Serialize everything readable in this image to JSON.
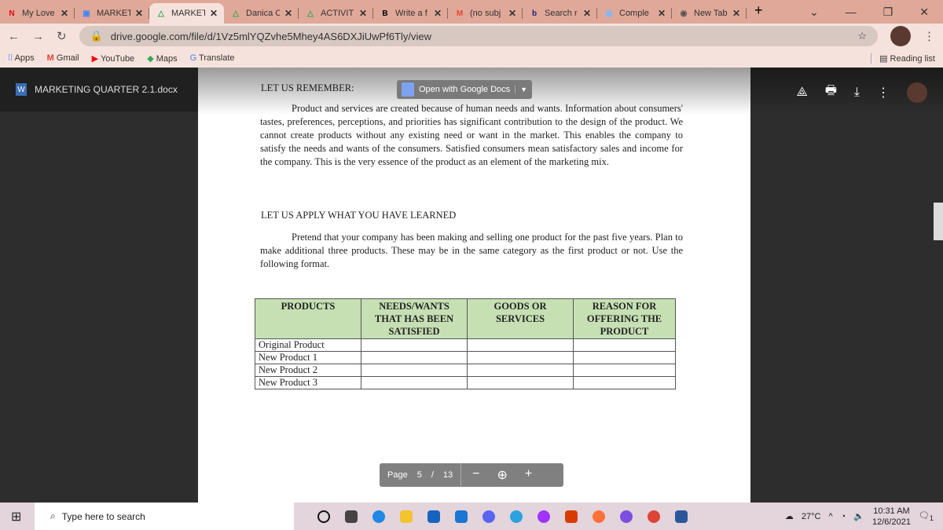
{
  "browser": {
    "tabs": [
      {
        "title": "My Love",
        "icon": "netflix-icon",
        "color": "#e50914",
        "glyph": "N"
      },
      {
        "title": "MARKET",
        "icon": "classroom-icon",
        "color": "#4285f4",
        "glyph": "▣"
      },
      {
        "title": "MARKET",
        "icon": "google-drive-icon",
        "color": "#34a853",
        "glyph": "△",
        "active": true
      },
      {
        "title": "Danica C",
        "icon": "google-drive-icon",
        "color": "#34a853",
        "glyph": "△"
      },
      {
        "title": "ACTIVITI",
        "icon": "google-drive-icon",
        "color": "#34a853",
        "glyph": "△"
      },
      {
        "title": "Write a f",
        "icon": "brainly-icon",
        "color": "#000000",
        "glyph": "B"
      },
      {
        "title": "(no subj",
        "icon": "gmail-icon",
        "color": "#ea4335",
        "glyph": "M"
      },
      {
        "title": "Search r",
        "icon": "bing-icon",
        "color": "#1a237e",
        "glyph": "b"
      },
      {
        "title": "Comple",
        "icon": "quizlet-icon",
        "color": "#8ab4f8",
        "glyph": "▦"
      },
      {
        "title": "New Tab",
        "icon": "chrome-icon",
        "color": "#555555",
        "glyph": "◉"
      }
    ],
    "url": "drive.google.com/file/d/1Vz5mlYQZvhe5Mhey4AS6DXJiUwPf6Tly/view",
    "bookmarks": [
      "Apps",
      "Gmail",
      "YouTube",
      "Maps",
      "Translate"
    ],
    "reading_list": "Reading list"
  },
  "viewer": {
    "filename": "MARKETING QUARTER 2.1.docx",
    "open_with": "Open with Google Docs",
    "page_label": "Page",
    "page_current": "5",
    "page_sep": "/",
    "page_total": "13"
  },
  "document": {
    "heading1": "LET US REMEMBER:",
    "para1": "Product and services are created because of human needs and wants. Information about consumers' tastes, preferences, perceptions, and priorities has significant contribution to the design of the product. We cannot create products without any existing need or want in the market. This enables the company to satisfy the needs and wants of the consumers. Satisfied consumers mean satisfactory sales and income for the company. This is the very essence of the product as an element of the marketing mix.",
    "heading2": "LET US APPLY WHAT YOU HAVE LEARNED",
    "para2": "Pretend that your company has been making and selling one product for the past five years. Plan to make additional three products. These may be in the same category as the first product or not. Use the following format.",
    "table": {
      "headers": [
        "PRODUCTS",
        "NEEDS/WANTS THAT HAS BEEN SATISFIED",
        "GOODS OR SERVICES",
        "REASON FOR OFFERING THE PRODUCT"
      ],
      "rows": [
        "Original Product",
        "New Product 1",
        "New Product 2",
        "New Product 3"
      ]
    }
  },
  "taskbar": {
    "search_placeholder": "Type here to search",
    "weather": "27°C",
    "time": "10:31 AM",
    "date": "12/6/2021",
    "notifications": "1"
  }
}
